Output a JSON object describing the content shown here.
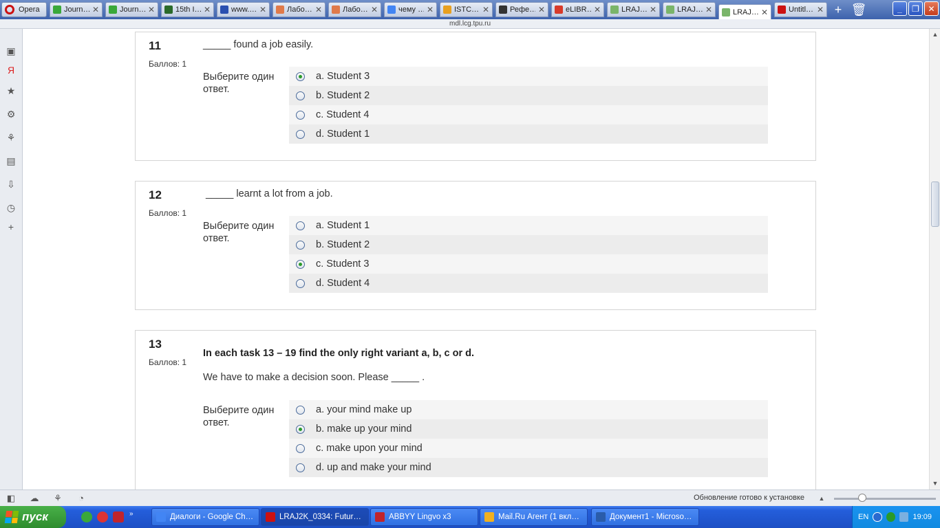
{
  "browser": {
    "menu_label": "Opera",
    "tabs": [
      {
        "label": "Journ…",
        "color": "#3aa83a"
      },
      {
        "label": "Journ…",
        "color": "#3aa83a"
      },
      {
        "label": "15th I…",
        "color": "#2a6a2a"
      },
      {
        "label": "www.…",
        "color": "#2a4fb0"
      },
      {
        "label": "Лабо…",
        "color": "#e07a4a"
      },
      {
        "label": "Лабо…",
        "color": "#e07a4a"
      },
      {
        "label": "чему …",
        "color": "#4285f4"
      },
      {
        "label": "ISTC…",
        "color": "#e8a020"
      },
      {
        "label": "Рефе…",
        "color": "#333333"
      },
      {
        "label": "eLIBR…",
        "color": "#d83a2a"
      },
      {
        "label": "LRAJ…",
        "color": "#7ab56a"
      },
      {
        "label": "LRAJ…",
        "color": "#7ab56a"
      },
      {
        "label": "LRAJ…",
        "color": "#7ab56a",
        "active": true
      },
      {
        "label": "Untitl…",
        "color": "#cc1111"
      }
    ],
    "address": "mdl.lcg.tpu.ru",
    "status_update": "Обновление готово к установке"
  },
  "quiz": {
    "questions": [
      {
        "number": "11",
        "grade": "Баллов: 1",
        "text": "_____ found a job easily.",
        "prompt": "Выберите один ответ.",
        "answers": [
          {
            "label": "a. Student 3",
            "selected": true
          },
          {
            "label": "b. Student 2",
            "selected": false
          },
          {
            "label": "c. Student 4",
            "selected": false
          },
          {
            "label": "d. Student 1",
            "selected": false
          }
        ]
      },
      {
        "number": "12",
        "grade": "Баллов: 1",
        "text": " _____ learnt a lot from a job.",
        "prompt": "Выберите один ответ.",
        "answers": [
          {
            "label": "a. Student 1",
            "selected": false
          },
          {
            "label": "b. Student 2",
            "selected": false
          },
          {
            "label": "c. Student 3",
            "selected": true
          },
          {
            "label": "d. Student 4",
            "selected": false
          }
        ]
      },
      {
        "number": "13",
        "grade": "Баллов: 1",
        "instruction": "In each task 13 – 19 find the only right variant a, b, c or d.",
        "text": "We have to make a decision soon. Please _____ .",
        "prompt": "Выберите один ответ.",
        "answers": [
          {
            "label": "a. your mind make up",
            "selected": false
          },
          {
            "label": "b. make up your mind",
            "selected": true
          },
          {
            "label": "c. make upon your mind",
            "selected": false
          },
          {
            "label": "d. up and make your mind",
            "selected": false
          }
        ]
      }
    ]
  },
  "taskbar": {
    "start_label": "пуск",
    "tasks": [
      {
        "label": "Диалоги - Google Ch…",
        "color": "#4285f4"
      },
      {
        "label": "LRAJ2K_0334: Futur…",
        "color": "#cc1111",
        "active": true
      },
      {
        "label": "ABBYY Lingvo x3",
        "color": "#c0242c"
      },
      {
        "label": "Mail.Ru Агент (1 вкл…",
        "color": "#f0b020"
      },
      {
        "label": "Документ1 - Microso…",
        "color": "#2a5caa"
      }
    ],
    "language": "EN",
    "clock": "19:09"
  }
}
